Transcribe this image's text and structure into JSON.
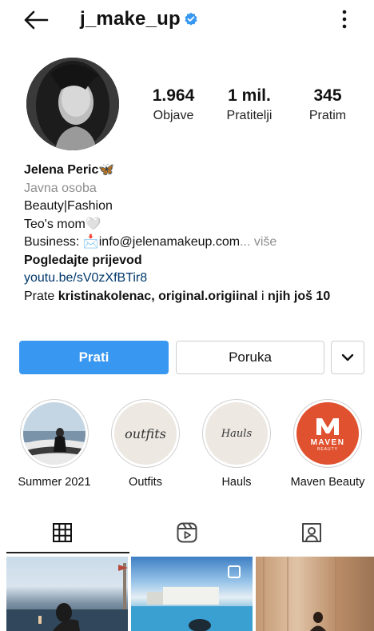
{
  "header": {
    "username": "j_make_up",
    "verified": true
  },
  "stats": [
    {
      "value": "1.964",
      "label": "Objave"
    },
    {
      "value": "1 mil.",
      "label": "Pratitelji"
    },
    {
      "value": "345",
      "label": "Pratim"
    }
  ],
  "bio": {
    "name": "Jelena Peric",
    "name_emoji": "🦋",
    "category": "Javna osoba",
    "line1": "Beauty|Fashion",
    "line2": "Teo's mom",
    "line2_emoji": "🤍",
    "line3_prefix": "Business: ",
    "line3_emoji": "📩",
    "line3_email": "info@jelenamakeup.com",
    "line3_ellipsis": "... ",
    "more": "više",
    "translation": "Pogledajte prijevod",
    "link": "youtu.be/sV0zXfBTir8",
    "followed_prefix": "Prate ",
    "followed_names": "kristinakolenac, original.origiinal",
    "followed_mid": " i ",
    "followed_rest": "njih još 10"
  },
  "actions": {
    "follow": "Prati",
    "message": "Poruka"
  },
  "highlights": [
    {
      "label": "Summer 2021"
    },
    {
      "label": "Outfits",
      "cover_text": "outfits"
    },
    {
      "label": "Hauls",
      "cover_text": "Hauls"
    },
    {
      "label": "Maven Beauty",
      "cover_text": "MAVEN",
      "cover_sub": "BEAUTY"
    }
  ],
  "tabs": [
    {
      "icon": "grid-icon",
      "active": true
    },
    {
      "icon": "reels-icon",
      "active": false
    },
    {
      "icon": "tagged-icon",
      "active": false
    }
  ],
  "colors": {
    "accent": "#3897f0",
    "link": "#00376b",
    "verified": "#3897f0",
    "maven": "#e0512f"
  }
}
